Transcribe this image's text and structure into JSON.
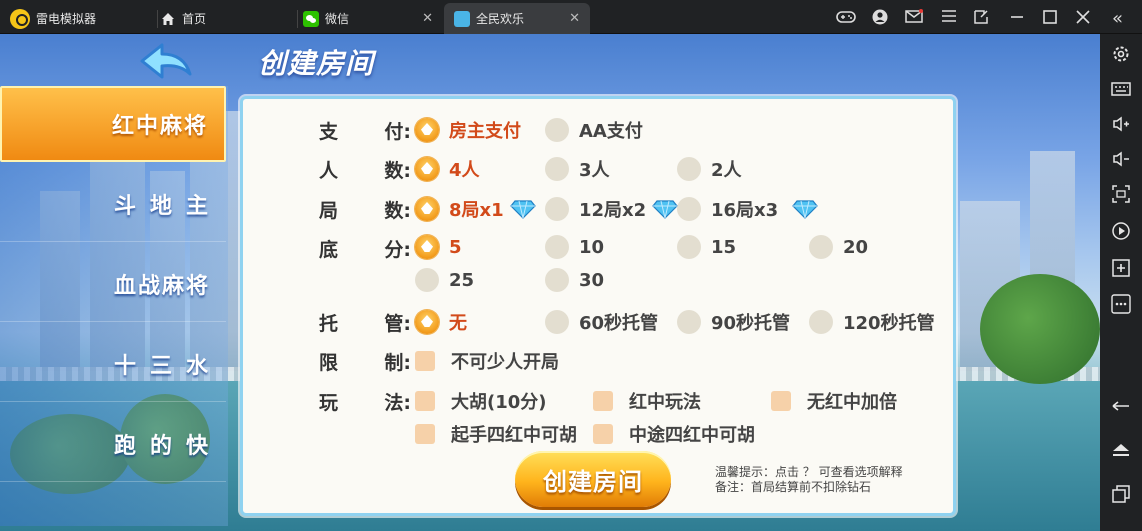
{
  "tabs": {
    "emulator": "雷电模拟器",
    "home": "首页",
    "wechat": "微信",
    "game": "全民欢乐"
  },
  "game": {
    "title": "创建房间",
    "menu": [
      "红中麻将",
      "斗地主",
      "血战麻将",
      "十三水",
      "跑的快"
    ],
    "active_menu": "红中麻将",
    "rows": {
      "pay": {
        "label_a": "支",
        "label_b": "付:",
        "options": [
          "房主支付",
          "AA支付"
        ],
        "selected": "房主支付"
      },
      "players": {
        "label_a": "人",
        "label_b": "数:",
        "options": [
          "4人",
          "3人",
          "2人"
        ],
        "selected": "4人"
      },
      "rounds": {
        "label_a": "局",
        "label_b": "数:",
        "options": [
          "8局x1",
          "12局x2",
          "16局x3"
        ],
        "selected": "8局x1"
      },
      "base": {
        "label_a": "底",
        "label_b": "分:",
        "options": [
          "5",
          "10",
          "15",
          "20",
          "25",
          "30"
        ],
        "selected": "5"
      },
      "auto": {
        "label_a": "托",
        "label_b": "管:",
        "options": [
          "无",
          "60秒托管",
          "90秒托管",
          "120秒托管"
        ],
        "selected": "无"
      },
      "limit": {
        "label_a": "限",
        "label_b": "制:",
        "options": [
          "不可少人开局"
        ]
      },
      "play": {
        "label_a": "玩",
        "label_b": "法:",
        "options": [
          "大胡(10分)",
          "红中玩法",
          "无红中加倍",
          "起手四红中可胡",
          "中途四红中可胡"
        ]
      }
    },
    "create_button": "创建房间",
    "tip_line1": "温馨提示：点击 ？ 可查看选项解释",
    "tip_line2": "备注：首局结算前不扣除钻石"
  },
  "colors": {
    "accent_orange": "#f29a1a",
    "selected_text": "#d24a1a",
    "panel_border": "#8fd2f0"
  }
}
